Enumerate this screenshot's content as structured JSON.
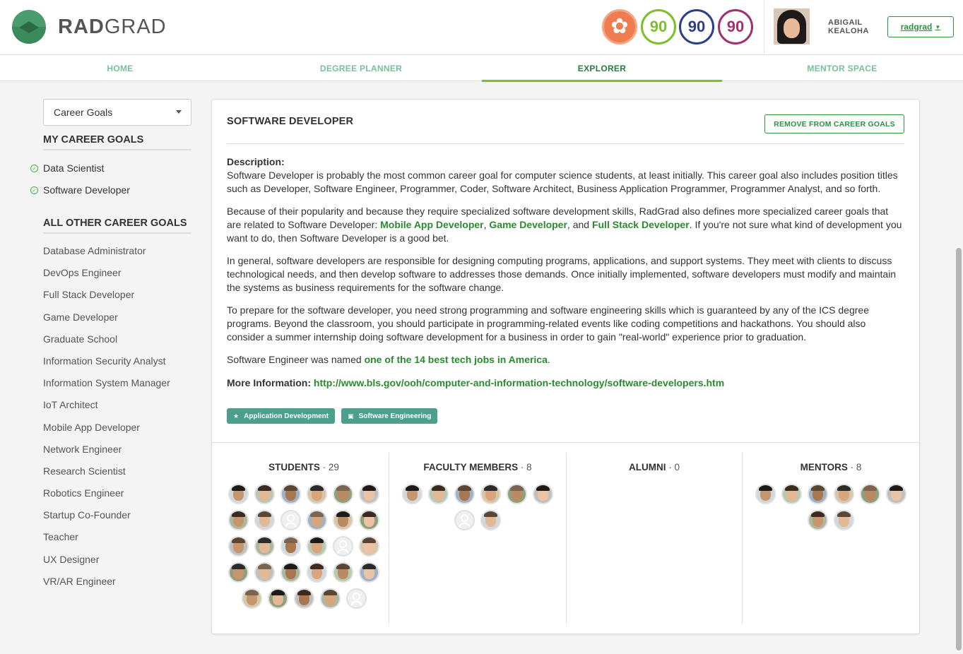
{
  "header": {
    "logo_text_bold": "RAD",
    "logo_text_rest": "GRAD",
    "badges": [
      {
        "name": "flower",
        "value": "✿",
        "color": "#f07d50"
      },
      {
        "name": "innovation",
        "value": "90",
        "color": "#7bbf2a"
      },
      {
        "name": "competency",
        "value": "90",
        "color": "#2b3e8c"
      },
      {
        "name": "experience",
        "value": "90",
        "color": "#a32f6e"
      }
    ],
    "user_first": "ABIGAIL",
    "user_last": "KEALOHA",
    "user_menu_label": "radgrad"
  },
  "nav": {
    "items": [
      {
        "label": "HOME"
      },
      {
        "label": "DEGREE PLANNER"
      },
      {
        "label": "EXPLORER"
      },
      {
        "label": "MENTOR SPACE"
      }
    ],
    "active": "EXPLORER"
  },
  "sidebar": {
    "dropdown_value": "Career Goals",
    "my_goals_heading": "MY CAREER GOALS",
    "my_goals": [
      "Data Scientist",
      "Software Developer"
    ],
    "other_heading": "ALL OTHER CAREER GOALS",
    "other_goals": [
      "Database Administrator",
      "DevOps Engineer",
      "Full Stack Developer",
      "Game Developer",
      "Graduate School",
      "Information Security Analyst",
      "Information System Manager",
      "IoT Architect",
      "Mobile App Developer",
      "Network Engineer",
      "Research Scientist",
      "Robotics Engineer",
      "Startup Co-Founder",
      "Teacher",
      "UX Designer",
      "VR/AR Engineer"
    ]
  },
  "main": {
    "title": "SOFTWARE DEVELOPER",
    "remove_button": "REMOVE FROM CAREER GOALS",
    "description_label": "Description:",
    "p1": "Software Developer is probably the most common career goal for computer science students, at least initially. This career goal also includes position titles such as Developer, Software Engineer, Programmer, Coder, Software Architect, Business Application Programmer, Programmer Analyst, and so forth.",
    "p2_a": "Because of their popularity and because they require specialized software development skills, RadGrad also defines more specialized career goals that are related to Software Developer: ",
    "p2_link1": "Mobile App Developer",
    "p2_sep1": ", ",
    "p2_link2": "Game Developer",
    "p2_sep2": ", and ",
    "p2_link3": "Full Stack Developer",
    "p2_b": ". If you're not sure what kind of development you want to do, then Software Developer is a good bet.",
    "p3": "In general, software developers are responsible for designing computing programs, applications, and support systems. They meet with clients to discuss technological needs, and then develop software to addresses those demands. Once initially implemented, software developers must modify and maintain the systems as business requirements for the software change.",
    "p4": "To prepare for the software developer, you need strong programming and software engineering skills which is guaranteed by any of the ICS degree programs. Beyond the classroom, you should participate in programming-related events like coding competitions and hackathons. You should also consider a summer internship doing software development for a business in order to gain \"real-world\" experience prior to graduation.",
    "p5_a": "Software Engineer was named ",
    "p5_link": "one of the 14 best tech jobs in America",
    "p5_b": ".",
    "more_label": "More Information: ",
    "more_link": "http://www.bls.gov/ooh/computer-and-information-technology/software-developers.htm",
    "tags": [
      {
        "label": "Application Development",
        "icon": "star-icon"
      },
      {
        "label": "Software Engineering",
        "icon": "briefcase-icon"
      }
    ],
    "columns": [
      {
        "label": "STUDENTS",
        "count": "29"
      },
      {
        "label": "FACULTY MEMBERS",
        "count": "8"
      },
      {
        "label": "ALUMNI",
        "count": "0"
      },
      {
        "label": "MENTORS",
        "count": "8"
      }
    ]
  },
  "colors": {
    "accent_green": "#2b9240",
    "tag_teal": "#4aa08c",
    "nav_active_bar": "#7bbf2a"
  }
}
